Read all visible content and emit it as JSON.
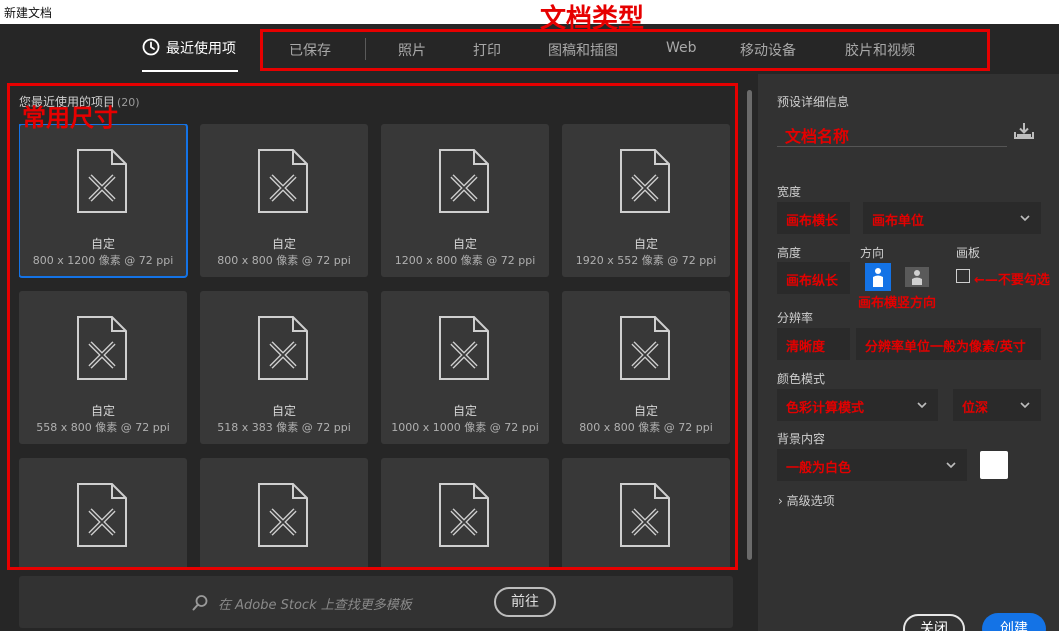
{
  "window": {
    "title": "新建文档"
  },
  "tabs": {
    "recent": "最近使用项",
    "items": [
      "已保存",
      "照片",
      "打印",
      "图稿和插图",
      "Web",
      "移动设备",
      "胶片和视频"
    ]
  },
  "annotations": {
    "doc_types": "文档类型",
    "common_sizes": "常用尺寸",
    "doc_name": "文档名称",
    "canvas_width": "画布横长",
    "canvas_unit": "画布单位",
    "canvas_height": "画布纵长",
    "orientation": "画布横竖方向",
    "artboard_note": "←—不要勾选",
    "resolution": "清晰度",
    "resolution_unit": "分辨率单位一般为像素/英寸",
    "color_mode": "色彩计算模式",
    "bit_depth": "位深",
    "background": "一般为白色"
  },
  "recent": {
    "heading": "您最近使用的项目",
    "count": "(20)",
    "cards": [
      {
        "name": "自定",
        "size": "800 x 1200 像素 @ 72 ppi",
        "selected": true
      },
      {
        "name": "自定",
        "size": "800 x 800 像素 @ 72 ppi"
      },
      {
        "name": "自定",
        "size": "1200 x 800 像素 @ 72 ppi"
      },
      {
        "name": "自定",
        "size": "1920 x 552 像素 @ 72 ppi"
      },
      {
        "name": "自定",
        "size": "558 x 800 像素 @ 72 ppi"
      },
      {
        "name": "自定",
        "size": "518 x 383 像素 @ 72 ppi"
      },
      {
        "name": "自定",
        "size": "1000 x 1000 像素 @ 72 ppi"
      },
      {
        "name": "自定",
        "size": "800 x 800 像素 @ 72 ppi"
      },
      {
        "name": "",
        "size": ""
      },
      {
        "name": "",
        "size": ""
      },
      {
        "name": "",
        "size": ""
      },
      {
        "name": "",
        "size": ""
      }
    ]
  },
  "stock": {
    "placeholder": "在 Adobe Stock 上查找更多模板",
    "go": "前往"
  },
  "panel": {
    "preset_details": "预设详细信息",
    "width": "宽度",
    "height": "高度",
    "orientation": "方向",
    "artboard": "画板",
    "resolution": "分辨率",
    "color_mode": "颜色模式",
    "background": "背景内容",
    "advanced": "高级选项",
    "close": "关闭",
    "create": "创建"
  },
  "colors": {
    "accent": "#1473e6",
    "annotation": "#e60000",
    "bg": "#262626",
    "panel": "#323232"
  }
}
